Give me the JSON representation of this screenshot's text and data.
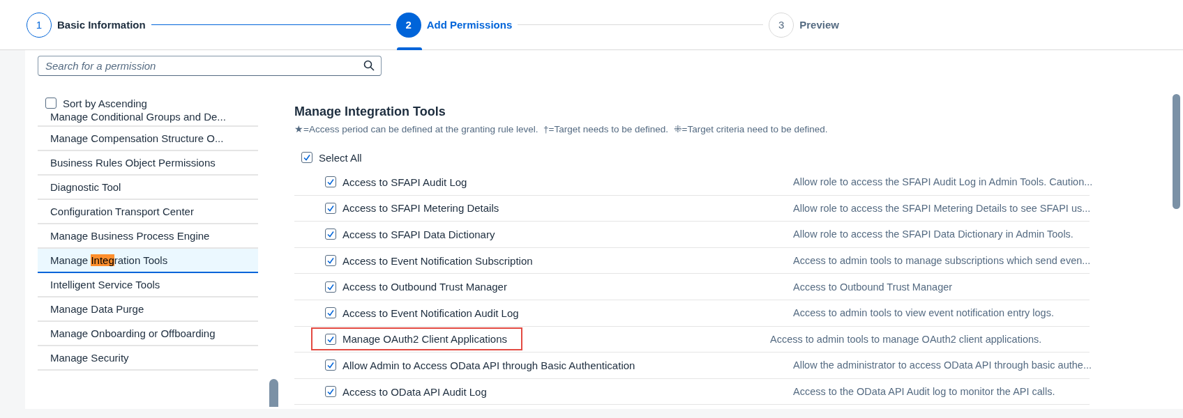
{
  "wizard": {
    "steps": [
      {
        "number": "1",
        "label": "Basic Information",
        "completed": true,
        "selected": false
      },
      {
        "number": "2",
        "label": "Add Permissions",
        "completed": false,
        "selected": true
      },
      {
        "number": "3",
        "label": "Preview",
        "completed": false,
        "selected": false
      }
    ]
  },
  "sidebar": {
    "search": {
      "placeholder": "Search for a permission"
    },
    "sort": {
      "label": "Sort by Ascending",
      "checked": false
    },
    "items": [
      {
        "label": "Manage Conditional Groups and De...",
        "selected": false
      },
      {
        "label": "Manage Compensation Structure O...",
        "selected": false
      },
      {
        "label": "Business Rules Object Permissions",
        "selected": false
      },
      {
        "label": "Diagnostic Tool",
        "selected": false
      },
      {
        "label": "Configuration Transport Center",
        "selected": false
      },
      {
        "label": "Manage Business Process Engine",
        "selected": false
      },
      {
        "parts": [
          {
            "text": "Manage ",
            "highlighted": false
          },
          {
            "text": "Integ",
            "highlighted": true
          },
          {
            "text": "ration Tools",
            "highlighted": false
          }
        ],
        "selected": true
      },
      {
        "label": "Intelligent Service Tools",
        "selected": false
      },
      {
        "label": "Manage Data Purge",
        "selected": false
      },
      {
        "label": "Manage Onboarding or Offboarding",
        "selected": false
      },
      {
        "label": "Manage Security",
        "selected": false
      }
    ]
  },
  "content": {
    "title": "Manage Integration Tools",
    "legend": "★=Access period can be defined at the granting rule level.  †=Target needs to be defined.  ⁜=Target criteria need to be defined.",
    "select_all": {
      "label": "Select All",
      "checked": true
    },
    "permissions": [
      {
        "name": "Access to SFAPI Audit Log",
        "description": "Allow role to access the SFAPI Audit Log in Admin Tools. Caution...",
        "checked": true,
        "outlined": false
      },
      {
        "name": "Access to SFAPI Metering Details",
        "description": "Allow role to access the SFAPI Metering Details to see SFAPI us...",
        "checked": true,
        "outlined": false
      },
      {
        "name": "Access to SFAPI Data Dictionary",
        "description": "Allow role to access the SFAPI Data Dictionary in Admin Tools.",
        "checked": true,
        "outlined": false
      },
      {
        "name": "Access to Event Notification Subscription",
        "description": "Access to admin tools to manage subscriptions which send even...",
        "checked": true,
        "outlined": false
      },
      {
        "name": "Access to Outbound Trust Manager",
        "description": "Access to Outbound Trust Manager",
        "checked": true,
        "outlined": false
      },
      {
        "name": "Access to Event Notification Audit Log",
        "description": "Access to admin tools to view event notification entry logs.",
        "checked": true,
        "outlined": false
      },
      {
        "name": "Manage OAuth2 Client Applications",
        "description": "Access to admin tools to manage OAuth2 client applications.",
        "checked": true,
        "outlined": true
      },
      {
        "name": "Allow Admin to Access OData API through Basic Authentication",
        "description": "Allow the administrator to access OData API through basic authe...",
        "checked": true,
        "outlined": false
      },
      {
        "name": "Access to OData API Audit Log",
        "description": "Access to the OData API Audit log to monitor the API calls.",
        "checked": true,
        "outlined": false
      }
    ]
  }
}
